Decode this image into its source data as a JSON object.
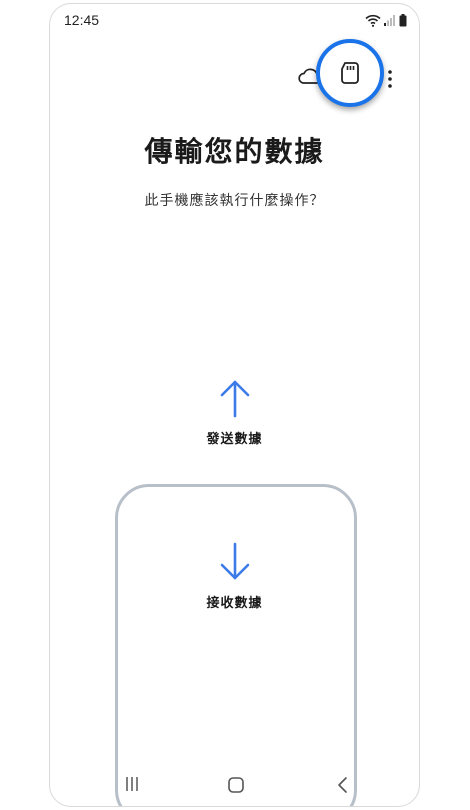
{
  "status_bar": {
    "time": "12:45"
  },
  "toolbar": {
    "icons": [
      "cloud-icon",
      "sd-card-icon",
      "more-vertical-icon"
    ]
  },
  "main": {
    "title": "傳輸您的數據",
    "subtitle": "此手機應該執行什麼操作？",
    "options": {
      "send_label": "發送數據",
      "receive_label": "接收數據"
    }
  },
  "nav_bar": {
    "icons": [
      "recent-apps-icon",
      "home-icon",
      "back-icon"
    ]
  },
  "colors": {
    "accent": "#1a73e8",
    "arrow": "#3b7be8",
    "frame": "#b7bfc8"
  }
}
